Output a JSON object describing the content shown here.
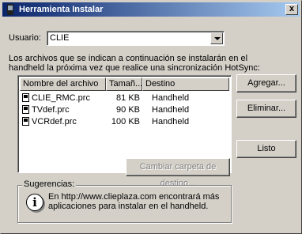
{
  "window": {
    "title": "Herramienta Instalar",
    "close_glyph": "x"
  },
  "user": {
    "label": "Usuario:",
    "value": "CLIE"
  },
  "description": {
    "line1": "Los archivos que se indican a continuación se instalarán en el",
    "line2": "handheld la próxima vez que realice una sincronización HotSync:"
  },
  "file_list": {
    "columns": [
      "Nombre del archivo",
      "Tamañ...",
      "Destino"
    ],
    "rows": [
      {
        "name": "CLIE_RMC.prc",
        "size": "81 KB",
        "destination": "Handheld"
      },
      {
        "name": "TVdef.prc",
        "size": "90 KB",
        "destination": "Handheld"
      },
      {
        "name": "VCRdef.prc",
        "size": "100 KB",
        "destination": "Handheld"
      }
    ]
  },
  "buttons": {
    "add": "Agregar...",
    "remove": "Eliminar...",
    "done": "Listo",
    "change_folder": "Cambiar carpeta de destino..."
  },
  "hints": {
    "title": "Sugerencias:",
    "line1": "En http://www.clieplaza.com encontrará más",
    "line2": "aplicaciones para instalar en el handheld.",
    "icon": "info-icon"
  }
}
